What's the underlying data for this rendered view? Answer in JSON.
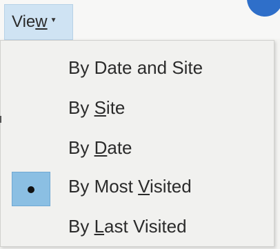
{
  "menu_bar": {
    "view_before": "Vie",
    "view_mnemonic": "w",
    "view_after": "",
    "arrow_icon": "caret-down-icon"
  },
  "colors": {
    "menu_background": "#f1f1ef",
    "selected_highlight": "#8bbfe3",
    "view_button_background": "#cfe3f3",
    "avatar": "#2f6fc9"
  },
  "view_menu": {
    "selected_index": 3,
    "items": [
      {
        "before": "By Date and Site",
        "mnemonic": "",
        "after": ""
      },
      {
        "before": "By ",
        "mnemonic": "S",
        "after": "ite"
      },
      {
        "before": "By ",
        "mnemonic": "D",
        "after": "ate"
      },
      {
        "before": "By Most ",
        "mnemonic": "V",
        "after": "isited"
      },
      {
        "before": "By ",
        "mnemonic": "L",
        "after": "ast Visited"
      }
    ]
  }
}
